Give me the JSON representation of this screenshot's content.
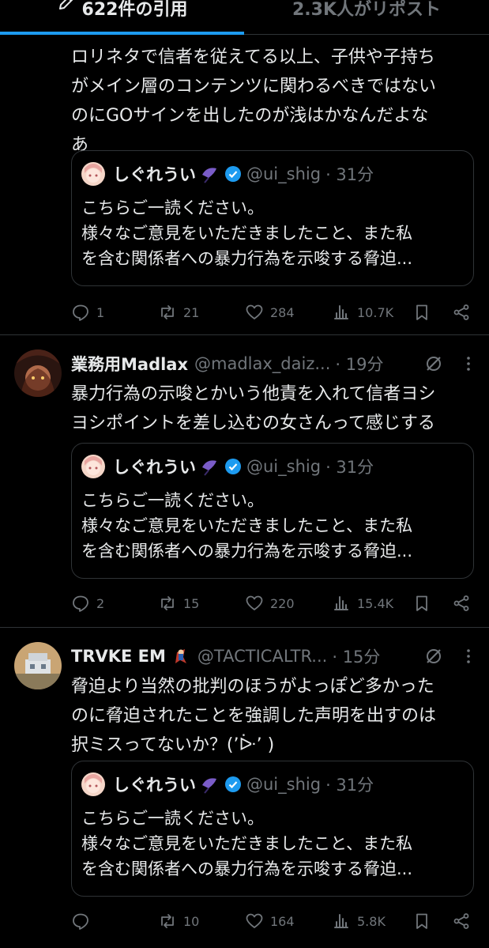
{
  "tabs": [
    {
      "label": "622件の引用",
      "active": true
    },
    {
      "label": "2.3K人がリポスト",
      "active": false
    }
  ],
  "quoted_post": {
    "name": "しぐれうい",
    "handle": "@ui_shig",
    "time": "· 31分",
    "text": "こちらご一読ください。\n様々なご意見をいただきましたこと、また私\nを含む関係者への暴力行為を示唆する脅迫..."
  },
  "posts": [
    {
      "text": "ロリネタで信者を従えてる以上、子供や子持ち\nがメイン層のコンテンツに関わるべきではない\nのにGOサインを出したのが浅はかなんだよな\nあ",
      "actions": {
        "replies": "1",
        "reposts": "21",
        "likes": "284",
        "views": "10.7K"
      }
    },
    {
      "name": "業務用Madlax",
      "handle": "@madlax_daiz...",
      "time": "· 19分",
      "text": "暴力行為の示唆とかいう他責を入れて信者ヨシ\nヨシポイントを差し込むの女さんって感じする",
      "actions": {
        "replies": "2",
        "reposts": "15",
        "likes": "220",
        "views": "15.4K"
      }
    },
    {
      "name": "TRVKE EM",
      "handle": "@TACTICALTR...",
      "time": "· 15分",
      "text": "脅迫より当然の批判のほうがよっぽど多かった\nのに脅迫されたことを強調した声明を出すのは\n択ミスってないか？(’ᐕ’ )",
      "actions": {
        "replies": "",
        "reposts": "10",
        "likes": "164",
        "views": "5.8K"
      }
    }
  ],
  "colors": {
    "background": "#000000",
    "text": "#e7e9ea",
    "muted": "#71767b",
    "border": "#2f3336",
    "accent": "#1d9bf0"
  }
}
